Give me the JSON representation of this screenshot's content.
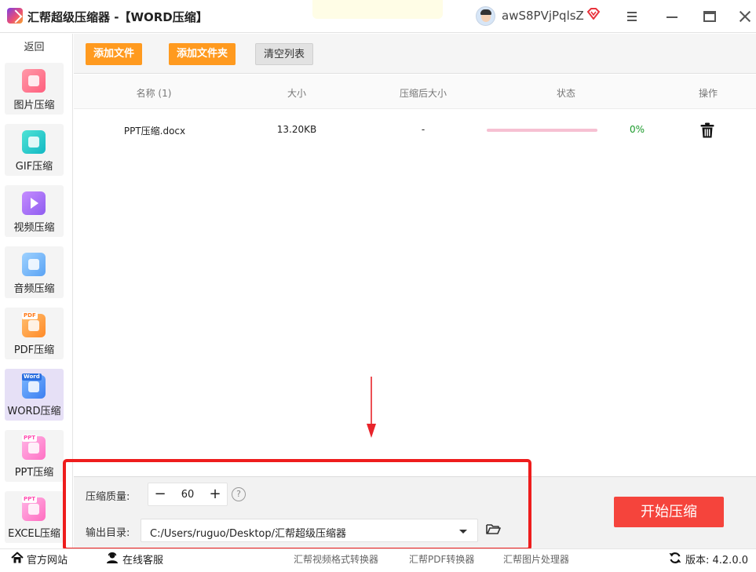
{
  "app": {
    "title": "汇帮超级压缩器  -【WORD压缩】",
    "username": "awS8PVjPqlsZ"
  },
  "sidebar": {
    "back_label": "返回",
    "items": [
      {
        "label": "图片压缩",
        "icon": "image-icon"
      },
      {
        "label": "GIF压缩",
        "icon": "gif-icon"
      },
      {
        "label": "视频压缩",
        "icon": "video-icon"
      },
      {
        "label": "音频压缩",
        "icon": "audio-icon"
      },
      {
        "label": "PDF压缩",
        "icon": "pdf-icon",
        "tag": "PDF"
      },
      {
        "label": "WORD压缩",
        "icon": "word-icon",
        "tag": "Word",
        "active": true
      },
      {
        "label": "PPT压缩",
        "icon": "ppt-icon",
        "tag": "PPT"
      },
      {
        "label": "EXCEL压缩",
        "icon": "excel-icon",
        "tag": "PPT"
      }
    ]
  },
  "toolbar": {
    "add_file": "添加文件",
    "add_folder": "添加文件夹",
    "clear_list": "清空列表"
  },
  "table": {
    "headers": {
      "name": "名称 (1)",
      "size": "大小",
      "compressed_size": "压缩后大小",
      "status": "状态",
      "actions": "操作"
    },
    "rows": [
      {
        "name": "PPT压缩.docx",
        "size": "13.20KB",
        "compressed_size": "-",
        "progress": 0,
        "percent": "0%"
      }
    ]
  },
  "settings": {
    "quality_label": "压缩质量:",
    "quality_value": "60",
    "minus": "−",
    "plus": "+",
    "help": "?",
    "output_label": "输出目录:",
    "output_path": "C:/Users/ruguo/Desktop/汇帮超级压缩器",
    "start_button": "开始压缩"
  },
  "footer": {
    "website": "官方网站",
    "support": "在线客服",
    "video_converter": "汇帮视频格式转换器",
    "pdf_converter": "汇帮PDF转换器",
    "image_processor": "汇帮图片处理器",
    "version": "版本:  4.2.0.0"
  },
  "colors": {
    "accent_orange": "#ff9a1f",
    "start_red": "#f5443c",
    "highlight_red": "#ee1d1d",
    "progress_track": "#f6c0d2",
    "percent_green": "#1a9a2a"
  }
}
